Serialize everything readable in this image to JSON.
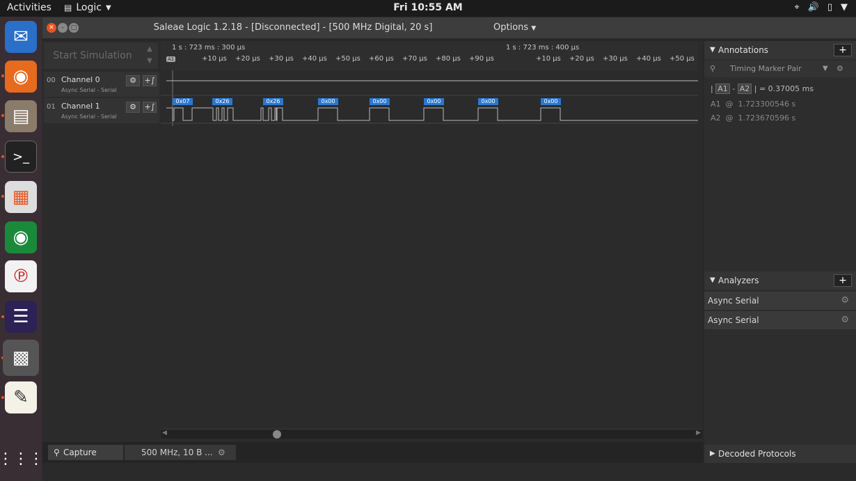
{
  "topbar": {
    "activities": "Activities",
    "app_name": "Logic",
    "clock": "Fri 10:55 AM"
  },
  "window": {
    "title": "Saleae Logic 1.2.18 - [Disconnected] - [500 MHz Digital, 20 s]",
    "options_label": "Options"
  },
  "toolbar": {
    "start_simulation": "Start Simulation"
  },
  "ruler": {
    "left_time": "1 s : 723 ms : 300 µs",
    "right_time": "1 s : 723 ms : 400 µs",
    "marker": "A1",
    "ticks_left": [
      "+10 µs",
      "+20 µs",
      "+30 µs",
      "+40 µs",
      "+50 µs",
      "+60 µs",
      "+70 µs",
      "+80 µs",
      "+90 µs"
    ],
    "ticks_right": [
      "+10 µs",
      "+20 µs",
      "+30 µs",
      "+40 µs",
      "+50 µs"
    ]
  },
  "channels": [
    {
      "number": "00",
      "name": "Channel 0",
      "analyzer": "Async Serial - Serial"
    },
    {
      "number": "01",
      "name": "Channel 1",
      "analyzer": "Async Serial - Serial"
    }
  ],
  "decoded_bytes": [
    "0x07",
    "0x26",
    "0x26",
    "0x00",
    "0x00",
    "0x00",
    "0x00",
    "0x00"
  ],
  "bottom": {
    "capture_label": "Capture",
    "rate_label": "500 MHz, 10 B ..."
  },
  "annotations": {
    "header": "Annotations",
    "marker_pair": "Timing Marker Pair",
    "delta_a": "A1",
    "delta_b": "A2",
    "delta_value": "= 0.37005 ms",
    "a1_label": "A1",
    "a1_value": "1.723300546 s",
    "a2_label": "A2",
    "a2_value": "1.723670596 s"
  },
  "analyzers": {
    "header": "Analyzers",
    "items": [
      "Async Serial",
      "Async Serial"
    ]
  },
  "decoded_protocols": {
    "header": "Decoded Protocols"
  }
}
